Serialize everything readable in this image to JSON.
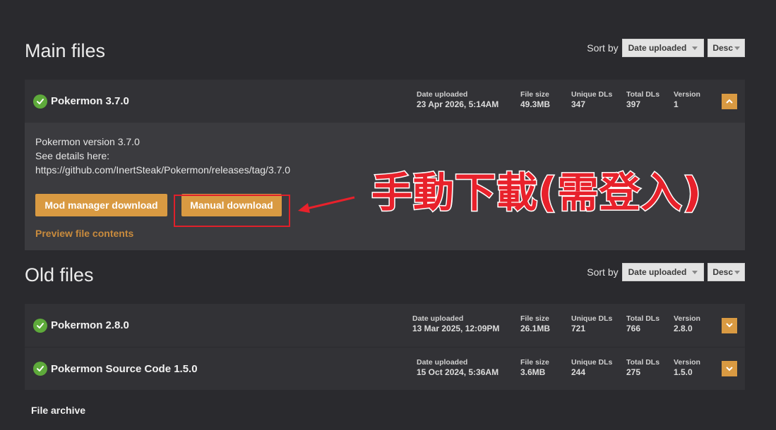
{
  "main_section": {
    "title": "Main files",
    "sort_label": "Sort by",
    "sort_value": "Date uploaded",
    "order_value": "Desc"
  },
  "old_section": {
    "title": "Old files",
    "sort_label": "Sort by",
    "sort_value": "Date uploaded",
    "order_value": "Desc"
  },
  "stat_labels": {
    "date": "Date uploaded",
    "size": "File size",
    "unique": "Unique DLs",
    "total": "Total DLs",
    "version": "Version"
  },
  "main_file": {
    "name": "Pokermon 3.7.0",
    "date": "23 Apr 2026, 5:14AM",
    "size": "49.3MB",
    "unique": "347",
    "total": "397",
    "version": "1",
    "desc_line1": "Pokermon version 3.7.0",
    "desc_line2": "See details here:",
    "desc_line3": "https://github.com/InertSteak/Pokermon/releases/tag/3.7.0",
    "mod_manager_label": "Mod manager download",
    "manual_label": "Manual download",
    "preview_label": "Preview file contents"
  },
  "old_files": [
    {
      "name": "Pokermon 2.8.0",
      "date": "13 Mar 2025, 12:09PM",
      "size": "26.1MB",
      "unique": "721",
      "total": "766",
      "version": "2.8.0"
    },
    {
      "name": "Pokermon Source Code 1.5.0",
      "date": "15 Oct 2024, 5:36AM",
      "size": "3.6MB",
      "unique": "244",
      "total": "275",
      "version": "1.5.0"
    }
  ],
  "annotation_text": "手動下載(需登入)",
  "file_archive_label": "File archive",
  "colors": {
    "accent": "#d99a42",
    "check": "#5eaa3b",
    "annotation": "#e8212b"
  }
}
